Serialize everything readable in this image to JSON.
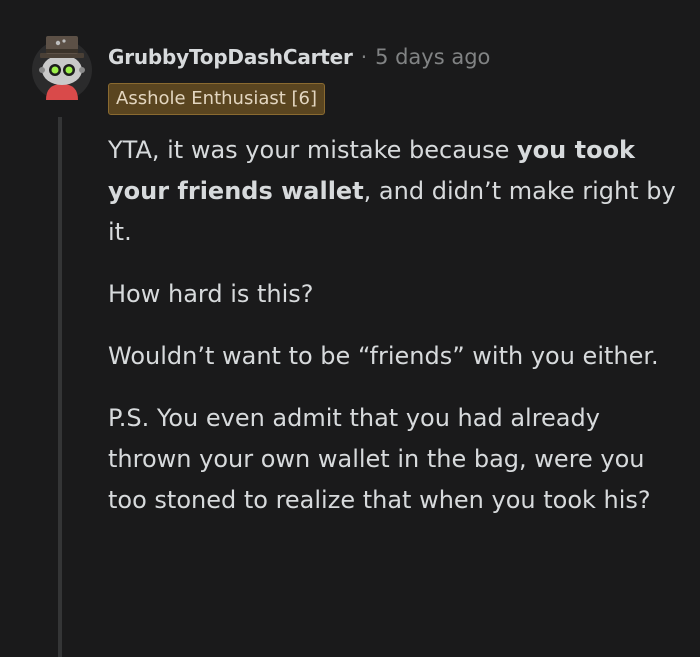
{
  "comment": {
    "username": "GrubbyTopDashCarter",
    "separator": "·",
    "timestamp": "5 days ago",
    "flair": "Asshole Enthusiast [6]",
    "flair_color": "#5a4520",
    "avatar_icon": "snoo-avatar-icon",
    "paragraphs": [
      {
        "before": "YTA, it was your mistake because ",
        "bold": "you took your friends wallet",
        "after": ", and didn’t make right by it."
      },
      {
        "text": "How hard is this?"
      },
      {
        "text": "Wouldn’t want to be “friends” with you either."
      },
      {
        "text": "P.S. You even admit that you had already thrown your own wallet in the bag, were you too stoned to realize that when you took his?"
      }
    ]
  }
}
